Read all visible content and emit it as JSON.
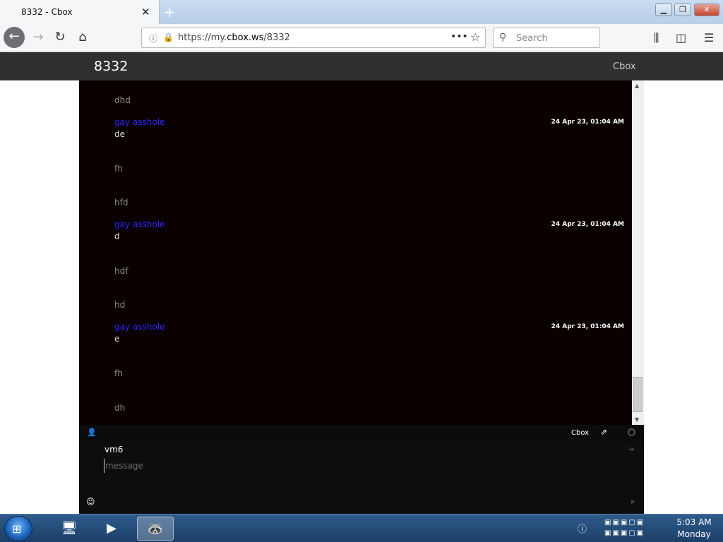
{
  "browser": {
    "tab_title": "8332 - Cbox",
    "tab_close": "✕",
    "new_tab": "+",
    "url_prefix": "https://my.",
    "url_domain": "cbox.ws",
    "url_path": "/8332",
    "search_placeholder": "Search"
  },
  "page": {
    "title": "8332",
    "brand_link": "Cbox"
  },
  "messages": [
    {
      "name": "",
      "text": "dhd",
      "time": "",
      "dim": true
    },
    {
      "name": "gay asshole",
      "text": "de",
      "time": "24 Apr 23, 01:04 AM",
      "dim": false
    },
    {
      "name": "",
      "text": "fh",
      "time": "",
      "dim": true
    },
    {
      "name": "",
      "text": "hfd",
      "time": "",
      "dim": true
    },
    {
      "name": "gay asshole",
      "text": "d",
      "time": "24 Apr 23, 01:04 AM",
      "dim": false
    },
    {
      "name": "",
      "text": "hdf",
      "time": "",
      "dim": true
    },
    {
      "name": "",
      "text": "hd",
      "time": "",
      "dim": true
    },
    {
      "name": "gay asshole",
      "text": "e",
      "time": "24 Apr 23, 01:04 AM",
      "dim": false
    },
    {
      "name": "",
      "text": "fh",
      "time": "",
      "dim": true
    },
    {
      "name": "",
      "text": "dh",
      "time": "",
      "dim": true
    }
  ],
  "chatbar": {
    "brand": "Cbox"
  },
  "input": {
    "username": "vm6",
    "placeholder": "message"
  },
  "taskbar": {
    "time": "5:03 AM",
    "day": "Monday"
  }
}
